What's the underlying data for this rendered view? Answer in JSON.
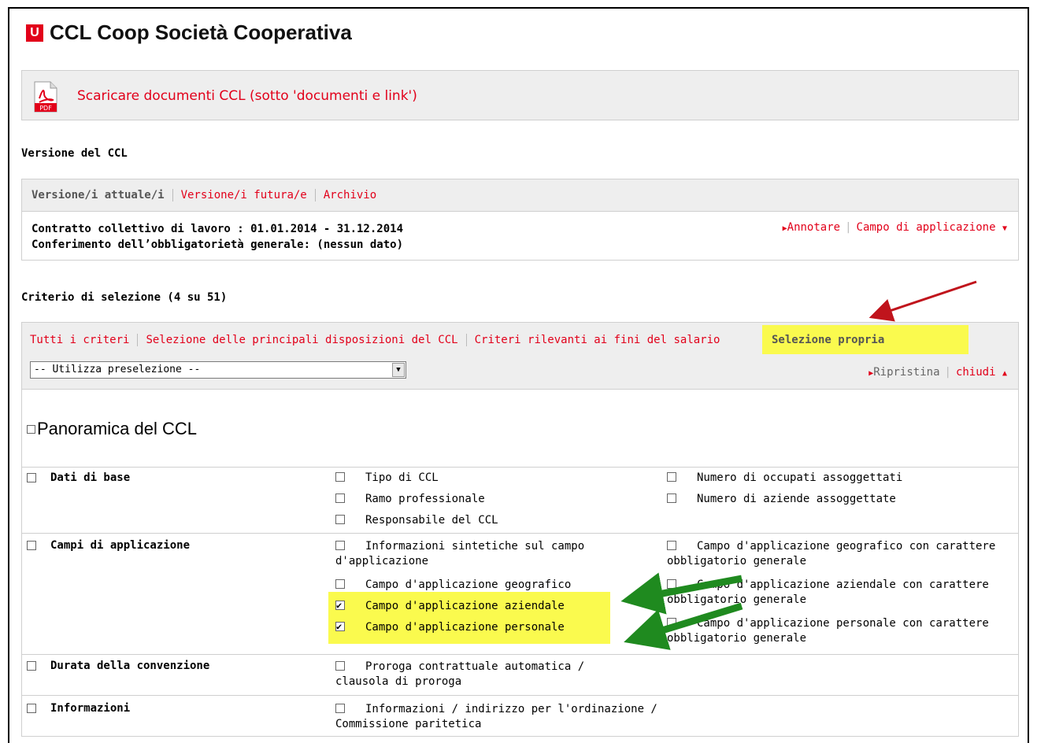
{
  "header": {
    "logo_letter": "U",
    "title": "CCL Coop Società Cooperativa"
  },
  "pdf": {
    "icon": "pdf-icon",
    "link": "Scaricare documenti CCL (sotto 'documenti e link')"
  },
  "version_section": {
    "heading": "Versione del CCL",
    "tabs": [
      "Versione/i attuale/i",
      "Versione/i futura/e",
      "Archivio"
    ],
    "line1": "Contratto collettivo di lavoro : 01.01.2014 - 31.12.2014",
    "line2": "Conferimento dell’obbligatorietà generale: (nessun dato)",
    "annotate": "Annotare",
    "scope": "Campo di applicazione"
  },
  "criteria_section": {
    "heading": "Criterio di selezione (4 su 51)",
    "tabs": [
      "Tutti i criteri",
      "Selezione delle principali disposizioni del CCL",
      "Criteri rilevanti ai fini del salario",
      "Selezione propria"
    ],
    "preselect": "-- Utilizza preselezione --",
    "reset": "Ripristina",
    "close": "chiudi",
    "overview": "Panoramica del CCL",
    "rows": [
      {
        "label": "Dati di base",
        "items": [
          "Tipo di CCL",
          "Ramo professionale",
          "Responsabile del CCL",
          "Numero di occupati assoggettati",
          "Numero di aziende assoggettate"
        ]
      },
      {
        "label": "Campi di applicazione",
        "items": [
          "Informazioni sintetiche sul campo d'applicazione",
          "Campo d'applicazione geografico",
          "Campo d'applicazione aziendale",
          "Campo d'applicazione personale",
          "Campo d'applicazione geografico con carattere obbligatorio generale",
          "Campo d'applicazione aziendale con carattere obbligatorio generale",
          "Campo d'applicazione personale con carattere obbligatorio generale"
        ]
      },
      {
        "label": "Durata della convenzione",
        "items": [
          "Proroga contrattuale automatica / clausola di proroga"
        ]
      },
      {
        "label": "Informazioni",
        "items": [
          "Informazioni / indirizzo per l'ordinazione / Commissione paritetica"
        ]
      }
    ]
  },
  "colors": {
    "accent": "#e2001a",
    "highlight": "#fafa4e",
    "arrow_red": "#c0141c",
    "arrow_green": "#1f8a1f"
  }
}
